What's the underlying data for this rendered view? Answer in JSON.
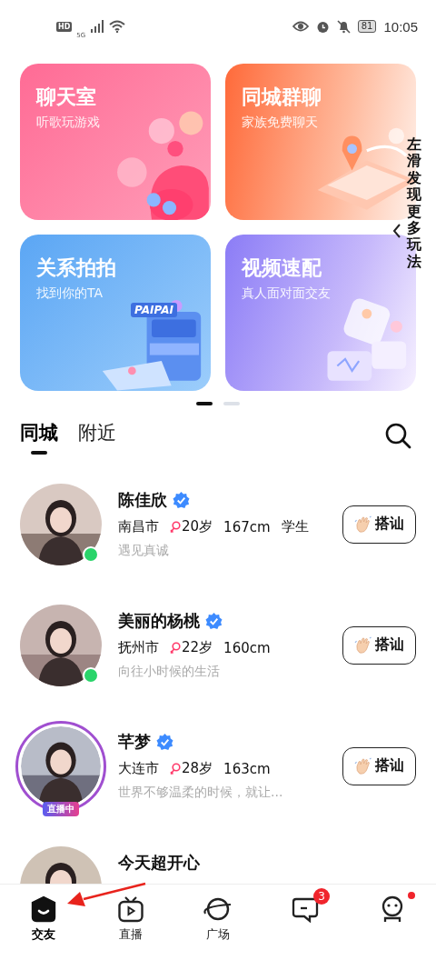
{
  "status_bar": {
    "hd": "HD",
    "network": "5G",
    "battery": "81",
    "time": "10:05"
  },
  "cards": [
    {
      "kind": "chat",
      "title": "聊天室",
      "subtitle": "听歌玩游戏"
    },
    {
      "kind": "family",
      "title": "同城群聊",
      "subtitle": "家族免费聊天"
    },
    {
      "kind": "paipai",
      "title": "关系拍拍",
      "subtitle": "找到你的TA",
      "machine_label": "PAIPAI"
    },
    {
      "kind": "video",
      "title": "视频速配",
      "subtitle": "真人面对面交友"
    }
  ],
  "side_hint": {
    "text": "左滑发现更多玩法"
  },
  "page_dots": [
    {
      "selected": true
    },
    {
      "selected": false
    }
  ],
  "tabs": [
    {
      "label": "同城",
      "selected": true
    },
    {
      "label": "附近",
      "selected": false
    }
  ],
  "users": [
    {
      "name": "陈佳欣",
      "verified": true,
      "city": "南昌市",
      "age": "20岁",
      "height": "167cm",
      "occupation": "学生",
      "bio": "遇见真诚",
      "online": true,
      "button": "搭讪"
    },
    {
      "name": "美丽的杨桃",
      "verified": true,
      "city": "抚州市",
      "age": "22岁",
      "height": "160cm",
      "bio": "向往小时候的生活",
      "online": true,
      "button": "搭讪"
    },
    {
      "name": "芊梦",
      "verified": true,
      "city": "大连市",
      "age": "28岁",
      "height": "163cm",
      "bio": "世界不够温柔的时候，就让...",
      "live": true,
      "live_badge": "直播中",
      "button": "搭讪"
    },
    {
      "name": "今天超开心"
    }
  ],
  "nav": [
    {
      "kind": "friends",
      "label": "交友",
      "selected": true
    },
    {
      "kind": "live",
      "label": "直播",
      "selected": false
    },
    {
      "kind": "square",
      "label": "广场",
      "selected": false
    },
    {
      "kind": "messages",
      "selected": false,
      "badge": "3"
    },
    {
      "kind": "profile",
      "selected": false,
      "dot": true
    }
  ]
}
